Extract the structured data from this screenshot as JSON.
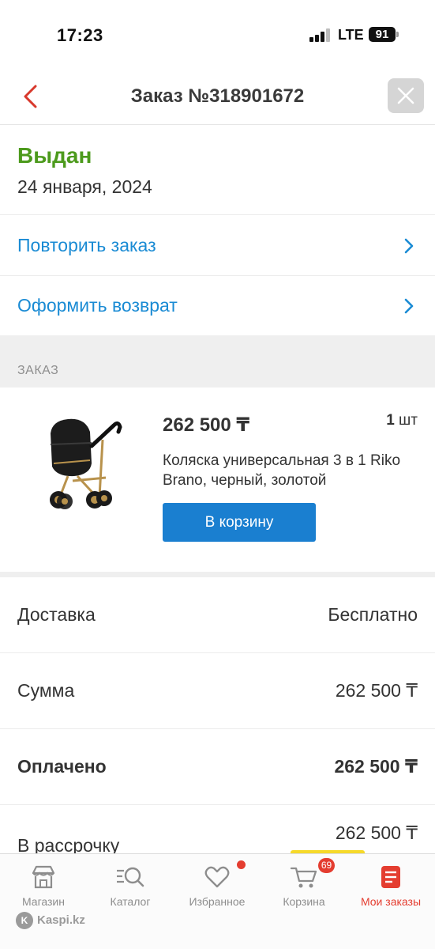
{
  "status_bar": {
    "time": "17:23",
    "network": "LTE",
    "battery": "91"
  },
  "header": {
    "title": "Заказ №318901672"
  },
  "order_status": {
    "label": "Выдан",
    "date": "24 января, 2024"
  },
  "actions": [
    {
      "label": "Повторить заказ"
    },
    {
      "label": "Оформить возврат"
    }
  ],
  "section_label": "ЗАКАЗ",
  "product": {
    "price": "262 500 ₸",
    "quantity_number": "1",
    "quantity_unit": "шт",
    "name": "Коляска универсальная 3 в 1 Riko Brano, черный, золотой",
    "cart_button": "В корзину"
  },
  "summary": [
    {
      "label": "Доставка",
      "value": "Бесплатно"
    },
    {
      "label": "Сумма",
      "value": "262 500 ₸"
    },
    {
      "label": "Оплачено",
      "value": "262 500 ₸"
    },
    {
      "label": "В рассрочку",
      "value": "262 500 ₸"
    }
  ],
  "nav": [
    {
      "label": "Магазин",
      "icon": "shop-icon"
    },
    {
      "label": "Каталог",
      "icon": "catalog-search-icon"
    },
    {
      "label": "Избранное",
      "icon": "heart-icon"
    },
    {
      "label": "Корзина",
      "icon": "cart-icon",
      "badge": "69"
    },
    {
      "label": "Мои заказы",
      "icon": "orders-icon"
    }
  ],
  "watermark": "Kaspi.kz",
  "colors": {
    "accent_blue": "#1a8bd4",
    "button_blue": "#1a7fd0",
    "status_green": "#4c9a1c",
    "active_red": "#e43d30"
  }
}
